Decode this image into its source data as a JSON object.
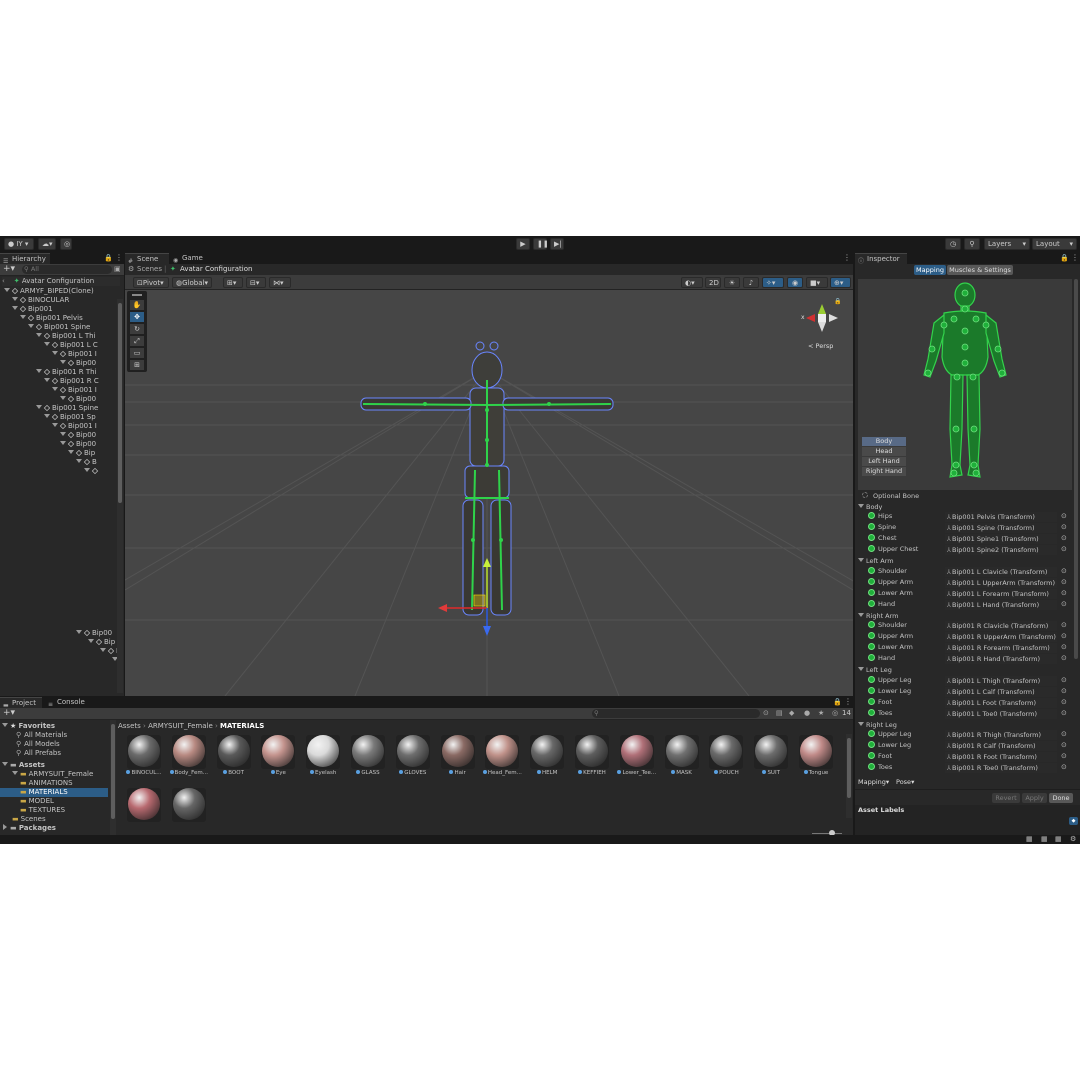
{
  "topbar": {
    "account": "IY",
    "layers": "Layers",
    "layout": "Layout"
  },
  "hierarchy": {
    "tab": "Hierarchy",
    "search_placeholder": "All",
    "scene": "Avatar Configuration",
    "items": [
      {
        "label": "ARMYF_BIPED(Clone)",
        "indent": 0
      },
      {
        "label": "BINOCULAR",
        "indent": 1
      },
      {
        "label": "Bip001",
        "indent": 1
      },
      {
        "label": "Bip001 Pelvis",
        "indent": 2
      },
      {
        "label": "Bip001 Spine",
        "indent": 3
      },
      {
        "label": "Bip001 L Thi",
        "indent": 4
      },
      {
        "label": "Bip001 L C",
        "indent": 5
      },
      {
        "label": "Bip001 I",
        "indent": 6
      },
      {
        "label": "Bip00",
        "indent": 7
      },
      {
        "label": "Bip001 R Thi",
        "indent": 4
      },
      {
        "label": "Bip001 R C",
        "indent": 5
      },
      {
        "label": "Bip001 I",
        "indent": 6
      },
      {
        "label": "Bip00",
        "indent": 7
      },
      {
        "label": "Bip001 Spine",
        "indent": 4
      },
      {
        "label": "Bip001 Sp",
        "indent": 5
      },
      {
        "label": "Bip001 I",
        "indent": 6
      },
      {
        "label": "Bip00",
        "indent": 7
      },
      {
        "label": "Bip00",
        "indent": 7
      },
      {
        "label": "Bip",
        "indent": 8
      },
      {
        "label": "B",
        "indent": 9
      },
      {
        "label": "",
        "indent": 10
      }
    ],
    "lower_items": [
      {
        "label": "Bip00",
        "indent": 6
      },
      {
        "label": "Bip",
        "indent": 7
      },
      {
        "label": "B",
        "indent": 8
      },
      {
        "label": "",
        "indent": 9
      }
    ]
  },
  "scene": {
    "tabs": [
      {
        "label": "Scene"
      },
      {
        "label": "Game"
      }
    ],
    "breadcrumb_root": "Scenes",
    "breadcrumb_current": "Avatar Configuration",
    "pivot": "Pivot",
    "global": "Global",
    "mode_2d": "2D",
    "persp": "< Persp",
    "gizmo_x": "x"
  },
  "project": {
    "tabs": [
      {
        "label": "Project"
      },
      {
        "label": "Console"
      }
    ],
    "favorites_title": "Favorites",
    "favorites": [
      "All Materials",
      "All Models",
      "All Prefabs"
    ],
    "assets_title": "Assets",
    "tree": [
      {
        "label": "ARMYSUIT_Female",
        "indent": 1,
        "selected": false
      },
      {
        "label": "ANIMATIONS",
        "indent": 2,
        "selected": false
      },
      {
        "label": "MATERIALS",
        "indent": 2,
        "selected": true
      },
      {
        "label": "MODEL",
        "indent": 2,
        "selected": false
      },
      {
        "label": "TEXTURES",
        "indent": 2,
        "selected": false
      },
      {
        "label": "Scenes",
        "indent": 1,
        "selected": false
      }
    ],
    "packages_title": "Packages",
    "breadcrumb": [
      "Assets",
      "ARMYSUIT_Female",
      "MATERIALS"
    ],
    "count": "14",
    "materials": [
      {
        "label": "BINOCUL...",
        "color": "#6b6b6b"
      },
      {
        "label": "Body_Fem...",
        "color": "#b88a82"
      },
      {
        "label": "BOOT",
        "color": "#5a5a5a"
      },
      {
        "label": "Eye",
        "color": "#c4948e"
      },
      {
        "label": "Eyelash",
        "color": "#dadada"
      },
      {
        "label": "GLASS",
        "color": "#7a7a7a"
      },
      {
        "label": "GLOVES",
        "color": "#6e6e6e"
      },
      {
        "label": "Hair",
        "color": "#8a6a64"
      },
      {
        "label": "Head_Fem...",
        "color": "#c0928a"
      },
      {
        "label": "HELM",
        "color": "#686868"
      },
      {
        "label": "KEFFIEH",
        "color": "#5e5e5e"
      },
      {
        "label": "Lower_Tee...",
        "color": "#b07078"
      },
      {
        "label": "MASK",
        "color": "#707070"
      },
      {
        "label": "POUCH",
        "color": "#6a6a6a"
      },
      {
        "label": "SUIT",
        "color": "#6c6c6c"
      },
      {
        "label": "Tongue",
        "color": "#c08a88"
      },
      {
        "label": "",
        "color": "#b86a70"
      },
      {
        "label": "",
        "color": "#666666"
      }
    ]
  },
  "inspector": {
    "tab": "Inspector",
    "mapping_tab": "Mapping",
    "muscles_tab": "Muscles & Settings",
    "view_buttons": [
      "Body",
      "Head",
      "Left Hand",
      "Right Hand"
    ],
    "optional_bone": "Optional Bone",
    "groups": [
      {
        "title": "Body",
        "bones": [
          {
            "name": "Hips",
            "value": "Bip001 Pelvis (Transform)"
          },
          {
            "name": "Spine",
            "value": "Bip001 Spine (Transform)"
          },
          {
            "name": "Chest",
            "value": "Bip001 Spine1 (Transform)"
          },
          {
            "name": "Upper Chest",
            "value": "Bip001 Spine2 (Transform)"
          }
        ]
      },
      {
        "title": "Left Arm",
        "bones": [
          {
            "name": "Shoulder",
            "value": "Bip001 L Clavicle (Transform)"
          },
          {
            "name": "Upper Arm",
            "value": "Bip001 L UpperArm (Transform)"
          },
          {
            "name": "Lower Arm",
            "value": "Bip001 L Forearm (Transform)"
          },
          {
            "name": "Hand",
            "value": "Bip001 L Hand (Transform)"
          }
        ]
      },
      {
        "title": "Right Arm",
        "bones": [
          {
            "name": "Shoulder",
            "value": "Bip001 R Clavicle (Transform)"
          },
          {
            "name": "Upper Arm",
            "value": "Bip001 R UpperArm (Transform)"
          },
          {
            "name": "Lower Arm",
            "value": "Bip001 R Forearm (Transform)"
          },
          {
            "name": "Hand",
            "value": "Bip001 R Hand (Transform)"
          }
        ]
      },
      {
        "title": "Left Leg",
        "bones": [
          {
            "name": "Upper Leg",
            "value": "Bip001 L Thigh (Transform)"
          },
          {
            "name": "Lower Leg",
            "value": "Bip001 L Calf (Transform)"
          },
          {
            "name": "Foot",
            "value": "Bip001 L Foot (Transform)"
          },
          {
            "name": "Toes",
            "value": "Bip001 L Toe0 (Transform)"
          }
        ]
      },
      {
        "title": "Right Leg",
        "bones": [
          {
            "name": "Upper Leg",
            "value": "Bip001 R Thigh (Transform)"
          },
          {
            "name": "Lower Leg",
            "value": "Bip001 R Calf (Transform)"
          },
          {
            "name": "Foot",
            "value": "Bip001 R Foot (Transform)"
          },
          {
            "name": "Toes",
            "value": "Bip001 R Toe0 (Transform)"
          }
        ]
      }
    ],
    "mapping_dropdown": "Mapping",
    "pose_dropdown": "Pose",
    "revert": "Revert",
    "apply": "Apply",
    "done": "Done",
    "asset_labels": "Asset Labels"
  },
  "colors": {
    "accent_blue": "#2c5d87",
    "bone_green": "#1fb03a",
    "panel": "#282828",
    "viewport": "#464646"
  }
}
